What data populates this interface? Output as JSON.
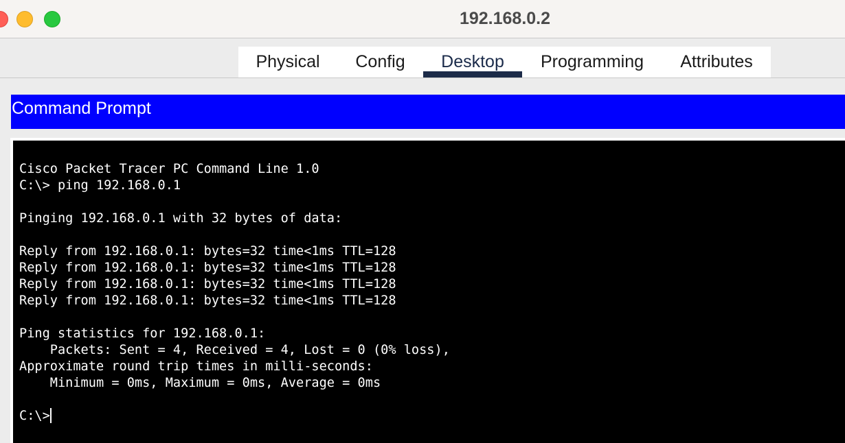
{
  "window": {
    "title": "192.168.0.2"
  },
  "tabs": [
    {
      "label": "Physical"
    },
    {
      "label": "Config"
    },
    {
      "label": "Desktop",
      "active": true
    },
    {
      "label": "Programming"
    },
    {
      "label": "Attributes"
    }
  ],
  "section": {
    "title": "Command Prompt",
    "color": "#0000ff"
  },
  "terminal": {
    "lines": [
      "Cisco Packet Tracer PC Command Line 1.0",
      "C:\\> ping 192.168.0.1",
      "",
      "Pinging 192.168.0.1 with 32 bytes of data:",
      "",
      "Reply from 192.168.0.1: bytes=32 time<1ms TTL=128",
      "Reply from 192.168.0.1: bytes=32 time<1ms TTL=128",
      "Reply from 192.168.0.1: bytes=32 time<1ms TTL=128",
      "Reply from 192.168.0.1: bytes=32 time<1ms TTL=128",
      "",
      "Ping statistics for 192.168.0.1:",
      "    Packets: Sent = 4, Received = 4, Lost = 0 (0% loss),",
      "Approximate round trip times in milli-seconds:",
      "    Minimum = 0ms, Maximum = 0ms, Average = 0ms",
      ""
    ],
    "prompt": "C:\\>"
  }
}
